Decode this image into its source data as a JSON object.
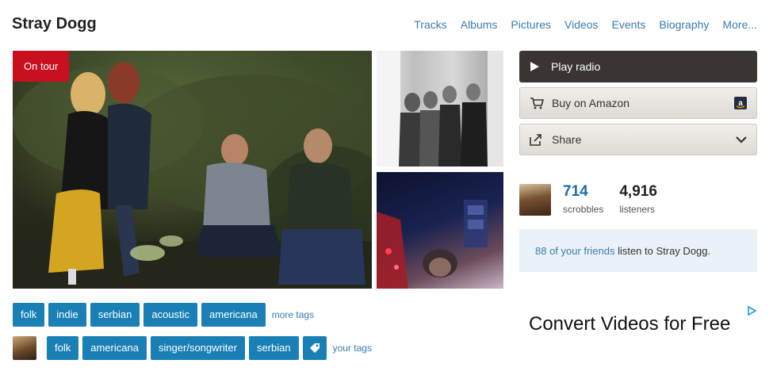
{
  "artist": {
    "name": "Stray Dogg"
  },
  "nav": [
    "Tracks",
    "Albums",
    "Pictures",
    "Videos",
    "Events",
    "Biography",
    "More..."
  ],
  "media": {
    "badge": "On tour"
  },
  "actions": {
    "play_radio": "Play radio",
    "buy_amazon": "Buy on Amazon",
    "share": "Share"
  },
  "stats": {
    "scrobbles_value": "714",
    "scrobbles_label": "scrobbles",
    "listeners_value": "4,916",
    "listeners_label": "listeners"
  },
  "friends": {
    "link": "88 of your friends",
    "text": " listen to Stray Dogg."
  },
  "tags": {
    "top": [
      "folk",
      "indie",
      "serbian",
      "acoustic",
      "americana"
    ],
    "more_label": "more tags",
    "yours": [
      "folk",
      "americana",
      "singer/songwriter",
      "serbian"
    ],
    "your_label": "your tags"
  },
  "ad": {
    "headline": "Convert Videos for Free"
  },
  "colors": {
    "accent_blue": "#1a7fb5",
    "tour_red": "#c8101e",
    "play_button": "#3a3533"
  },
  "icons": {
    "play": "play-icon",
    "cart": "cart-icon",
    "amazon": "amazon-logo-icon",
    "share": "share-icon",
    "chevron": "chevron-down-icon",
    "tag": "tag-icon",
    "adchoices": "adchoices-icon"
  }
}
